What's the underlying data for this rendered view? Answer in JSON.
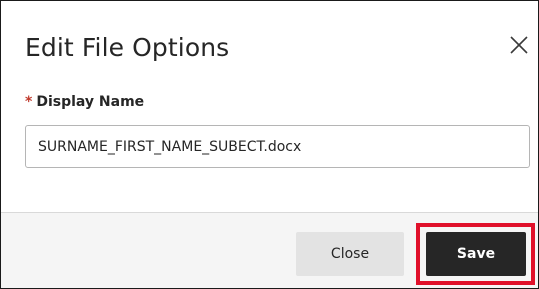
{
  "dialog": {
    "title": "Edit File Options",
    "close_icon": "close-x-icon"
  },
  "field": {
    "required_marker": "*",
    "label": "Display Name",
    "value": "SURNAME_FIRST_NAME_SUBECT.docx"
  },
  "footer": {
    "close_label": "Close",
    "save_label": "Save"
  },
  "colors": {
    "required": "#c0392b",
    "save_bg": "#262626",
    "close_bg": "#e3e3e3",
    "highlight": "#e0102a",
    "footer_bg": "#f5f5f5"
  }
}
